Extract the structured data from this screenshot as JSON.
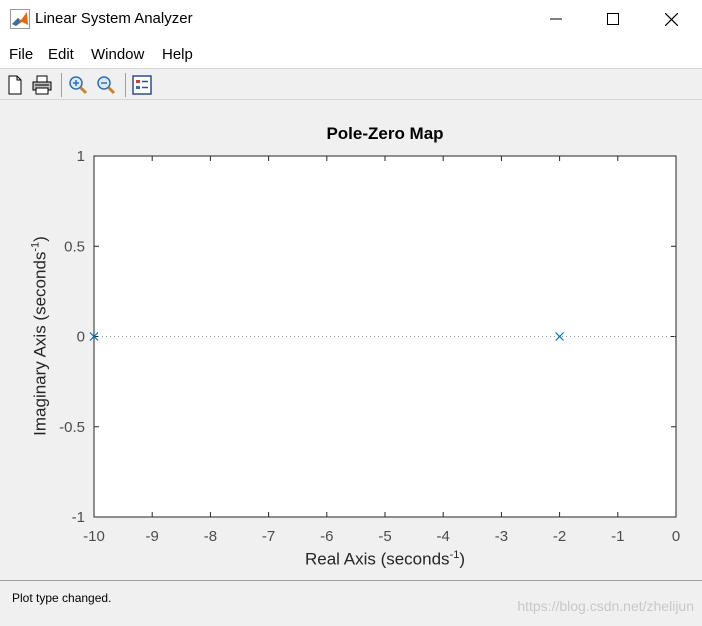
{
  "window": {
    "title": "Linear System Analyzer"
  },
  "menu": {
    "items": [
      "File",
      "Edit",
      "Window",
      "Help"
    ]
  },
  "toolbar": {
    "buttons": [
      "new-icon",
      "print-icon",
      "zoom-in-icon",
      "zoom-out-icon",
      "legend-icon"
    ]
  },
  "chart_data": {
    "type": "scatter",
    "title": "Pole-Zero Map",
    "xlabel": "Real Axis (seconds",
    "xlabel_sup": "-1",
    "xlabel_end": ")",
    "ylabel": "Imaginary Axis (seconds",
    "ylabel_sup": "-1",
    "ylabel_end": ")",
    "xlim": [
      -10,
      0
    ],
    "ylim": [
      -1,
      1
    ],
    "xticks": [
      -10,
      -9,
      -8,
      -7,
      -6,
      -5,
      -4,
      -3,
      -2,
      -1,
      0
    ],
    "yticks": [
      1,
      0.5,
      0,
      -0.5,
      -1
    ],
    "series": [
      {
        "marker": "x",
        "points": [
          [
            -10,
            0
          ],
          [
            -2,
            0
          ]
        ]
      }
    ],
    "colors": {
      "series": "#0072bd"
    }
  },
  "status": {
    "text": "Plot type changed.",
    "watermark": "https://blog.csdn.net/zhelijun"
  }
}
